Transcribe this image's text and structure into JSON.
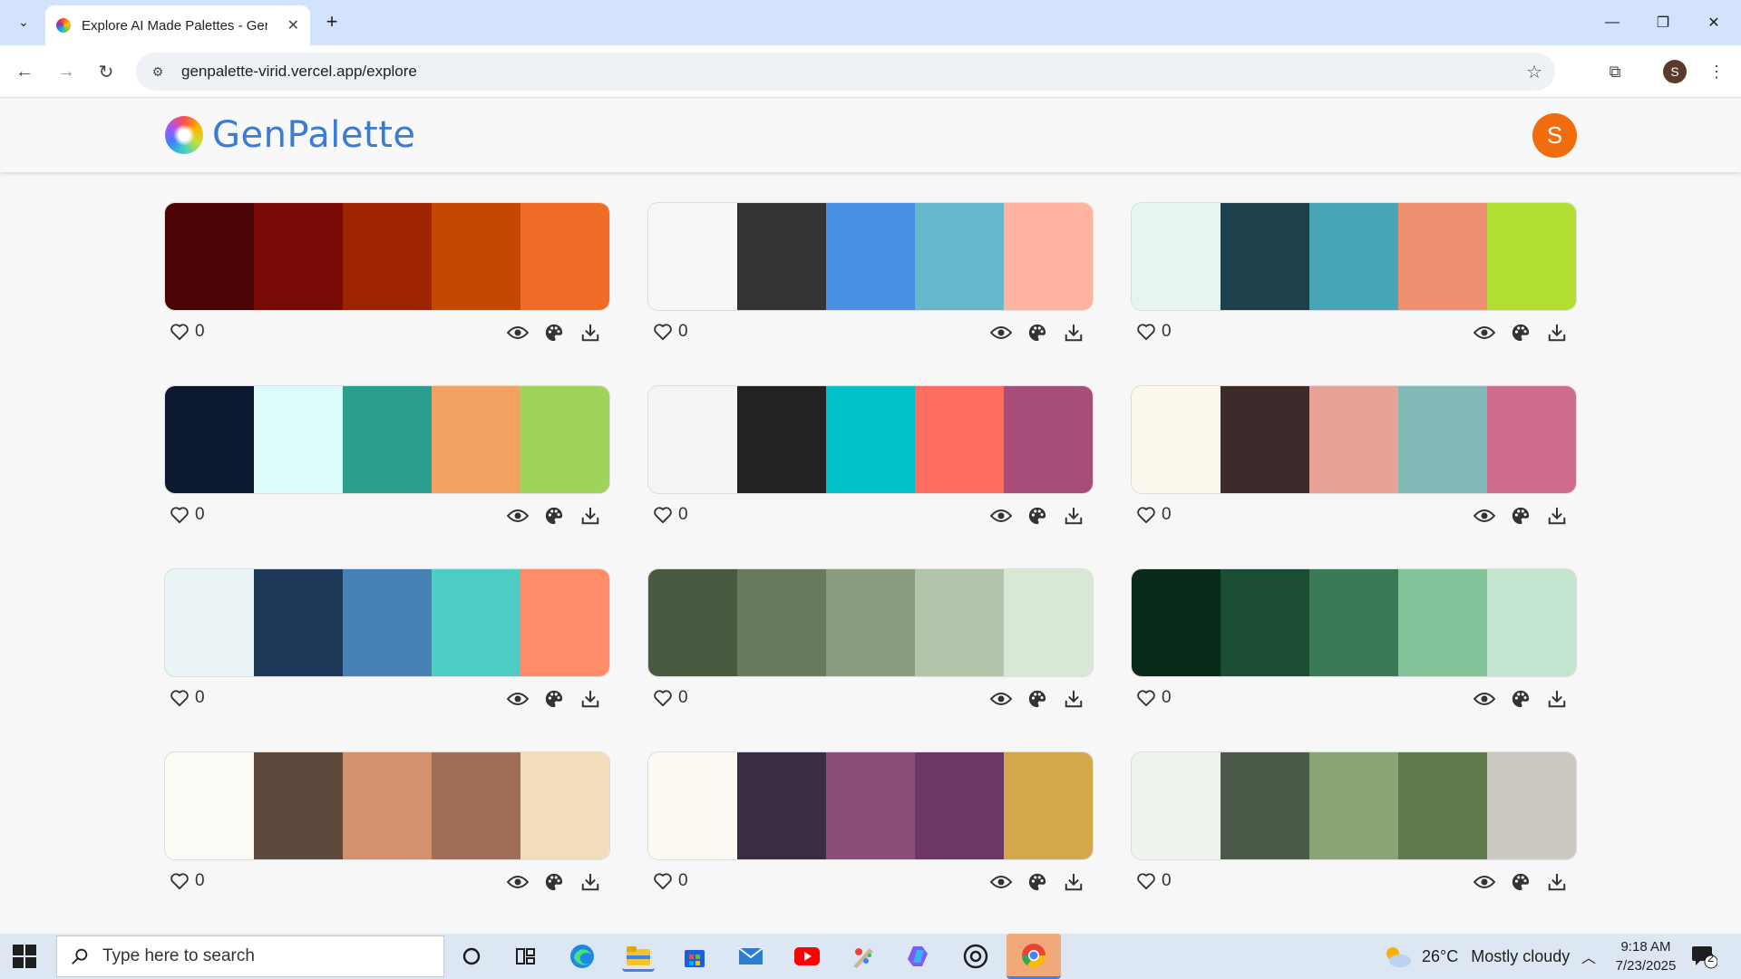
{
  "browser": {
    "tab_title": "Explore AI Made Palettes - GenPalette",
    "url": "genpalette-virid.vercel.app/explore",
    "profile_initial": "S"
  },
  "app": {
    "brand": "GenPalette",
    "user_initial": "S"
  },
  "palettes": [
    {
      "likes": "0",
      "colors": [
        "#4a0404",
        "#7a0a06",
        "#9e2400",
        "#c44800",
        "#ef6c26"
      ]
    },
    {
      "likes": "0",
      "colors": [
        "#f7f7f7",
        "#333333",
        "#4a90e2",
        "#67b8cc",
        "#ffb3a0"
      ]
    },
    {
      "likes": "0",
      "colors": [
        "#e6f5f0",
        "#1c404c",
        "#47a6b6",
        "#ee8f70",
        "#b3de33"
      ]
    },
    {
      "likes": "0",
      "colors": [
        "#0c1830",
        "#dffcfc",
        "#2a9e8f",
        "#f4a261",
        "#9fd35b"
      ]
    },
    {
      "likes": "0",
      "colors": [
        "#f4f4f4",
        "#222222",
        "#00c1c9",
        "#ff6f61",
        "#a64d79"
      ]
    },
    {
      "likes": "0",
      "colors": [
        "#fdf8ee",
        "#3d2a2a",
        "#e8a398",
        "#80b9b5",
        "#cf6b8a"
      ]
    },
    {
      "likes": "0",
      "colors": [
        "#eaf3f5",
        "#1d3957",
        "#4682b4",
        "#4ecdc4",
        "#ff8c69"
      ]
    },
    {
      "likes": "0",
      "colors": [
        "#4a5a40",
        "#6a7a5d",
        "#8c9c80",
        "#b2c4aa",
        "#d8e8d4"
      ]
    },
    {
      "likes": "0",
      "colors": [
        "#0a2a1a",
        "#1a4d33",
        "#3b7a57",
        "#82c39a",
        "#c4e6d1"
      ]
    },
    {
      "likes": "0",
      "colors": [
        "#fdfbf6",
        "#5e4a3c",
        "#d4916e",
        "#9e6e56",
        "#f2ddbb"
      ]
    },
    {
      "likes": "0",
      "colors": [
        "#fcf8f2",
        "#3a2c44",
        "#8c4d7b",
        "#6c3866",
        "#d4a84a"
      ]
    },
    {
      "likes": "0",
      "colors": [
        "#eef3ee",
        "#4c5a4a",
        "#8aa474",
        "#5e7a4c",
        "#ccc8c2"
      ]
    }
  ],
  "taskbar": {
    "search_placeholder": "Type here to search",
    "weather_temp": "26°C",
    "weather_desc": "Mostly cloudy",
    "time": "9:18 AM",
    "date": "7/23/2025",
    "notifications": "2"
  }
}
